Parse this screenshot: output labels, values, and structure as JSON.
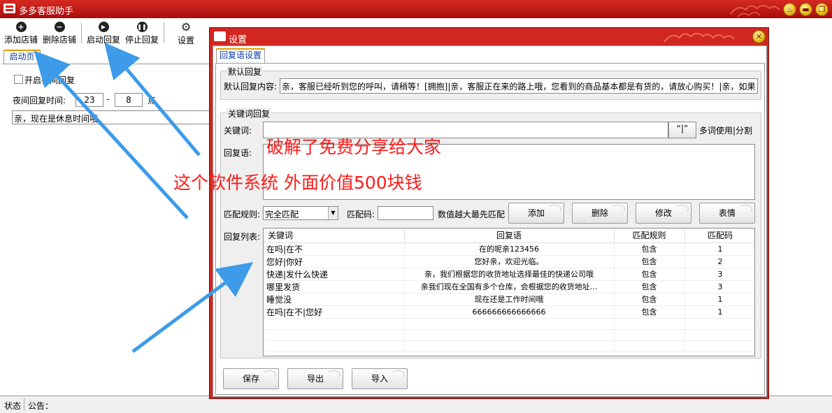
{
  "app": {
    "title": "多多客服助手"
  },
  "window_controls": {
    "settings": "♨",
    "minimize": "▬",
    "maximize": "❐",
    "close": "✕"
  },
  "toolbar": {
    "add_shop": "添加店铺",
    "delete_shop": "删除店铺",
    "start_reply": "启动回复",
    "stop_reply": "停止回复",
    "settings": "设置"
  },
  "left": {
    "tab": "启动页",
    "night_checkbox": "开启夜间回复",
    "night_time_label": "夜间回复时间:",
    "night_from": "23",
    "dash": "-",
    "night_to": "8",
    "hour_unit": "点",
    "night_message": "亲，现在是休息时间哦"
  },
  "status": {
    "state": "状态",
    "notice": "公告："
  },
  "dialog": {
    "title": "设置",
    "close": "✕",
    "tab": "回复语设置",
    "default_group": {
      "legend": "默认回复",
      "content_label": "默认回复内容:",
      "content_value": "亲，客服已经听到您的呼叫，请稍等！[拥抱]|亲，客服正在来的路上哦，您看到的商品基本都是有货的，请放心购买！|亲，如果"
    },
    "keyword_group": {
      "legend": "关键词回复",
      "keyword_label": "关键词:",
      "keyword_value": "",
      "quote_button": "“|”",
      "multi_hint": "多词使用|分割",
      "reply_label": "回复语:",
      "reply_value": "",
      "match_rule_label": "匹配规则:",
      "match_rule_value": "完全匹配",
      "match_code_label": "匹配码:",
      "match_code_value": "",
      "priority_hint": "数值越大最先匹配",
      "add_button": "添加",
      "delete_button": "删除",
      "edit_button": "修改",
      "emoji_button": "表情",
      "list_label": "回复列表:",
      "columns": [
        "关键词",
        "回复语",
        "匹配规则",
        "匹配码"
      ],
      "rows": [
        [
          "在吗|在不",
          "在的呢亲123456",
          "包含",
          "1"
        ],
        [
          "您好|你好",
          "您好亲，欢迎光临。",
          "包含",
          "2"
        ],
        [
          "快递|发什么快递",
          "亲，我们根据您的收货地址选择最佳的快递公司哦",
          "包含",
          "3"
        ],
        [
          "哪里发货",
          "亲我们现在全国有多个仓库，会根据您的收货地址...",
          "包含",
          "3"
        ],
        [
          "睡觉没",
          "现在还是工作时间哦",
          "包含",
          "1"
        ],
        [
          "在吗|在不|您好",
          "666666666666666",
          "包含",
          "1"
        ]
      ]
    },
    "save_button": "保存",
    "export_button": "导出",
    "import_button": "导入"
  },
  "overlay": {
    "text1": "破解了免费分享给大家",
    "text2": "这个软件系统 外面价值500块钱"
  },
  "colors": {
    "accent": "#d22721",
    "overlay_text": "#ff1a1a",
    "arrow": "#3d9be9",
    "tab_link": "#0a3aa6"
  }
}
